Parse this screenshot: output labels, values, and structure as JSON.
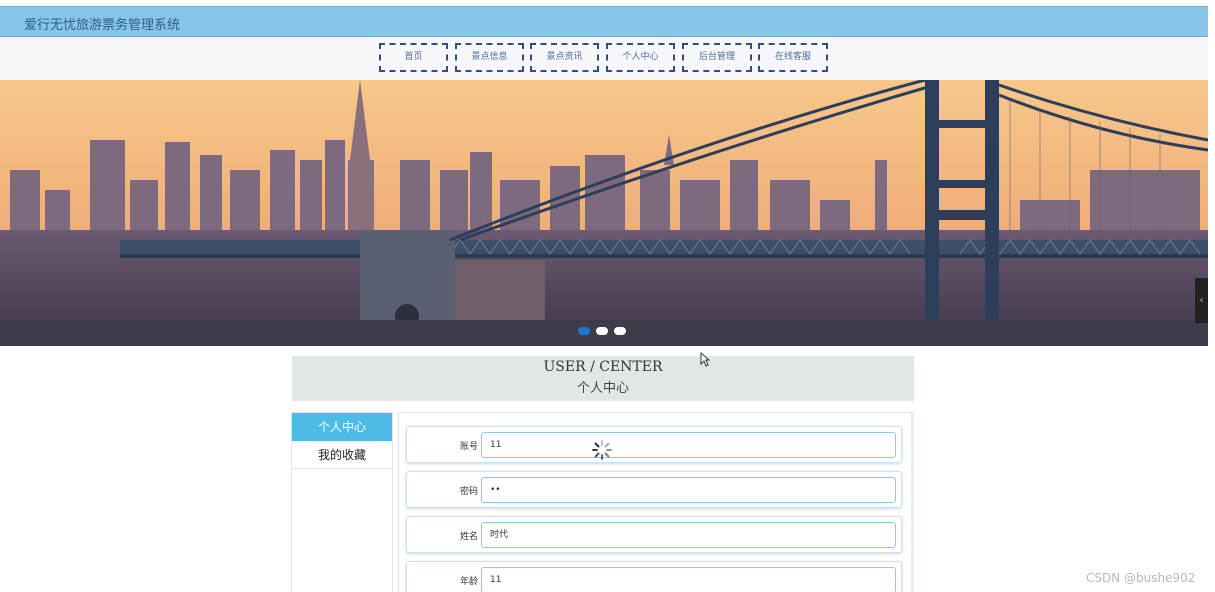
{
  "header": {
    "title": "爱行无忧旅游票务管理系统"
  },
  "nav": {
    "items": [
      "首页",
      "景点信息",
      "景点资讯",
      "个人中心",
      "后台管理",
      "在线客服"
    ]
  },
  "banner": {
    "slide_count": 3,
    "active_slide": 0,
    "next_icon": "chevron-left-icon"
  },
  "section": {
    "title_en": "USER / CENTER",
    "title_cn": "个人中心"
  },
  "sidebar": {
    "items": [
      {
        "label": "个人中心",
        "active": true
      },
      {
        "label": "我的收藏",
        "active": false
      }
    ]
  },
  "form": {
    "fields": [
      {
        "label": "账号",
        "value": "11"
      },
      {
        "label": "密码",
        "value": "••"
      },
      {
        "label": "姓名",
        "value": "时代"
      },
      {
        "label": "年龄",
        "value": "11"
      }
    ]
  },
  "watermark": "CSDN @bushe902",
  "colors": {
    "header_bg": "#86c5e6",
    "nav_border": "#2e4f86",
    "active_menu": "#4dbbe6",
    "section_bg": "#e1e6e9"
  }
}
